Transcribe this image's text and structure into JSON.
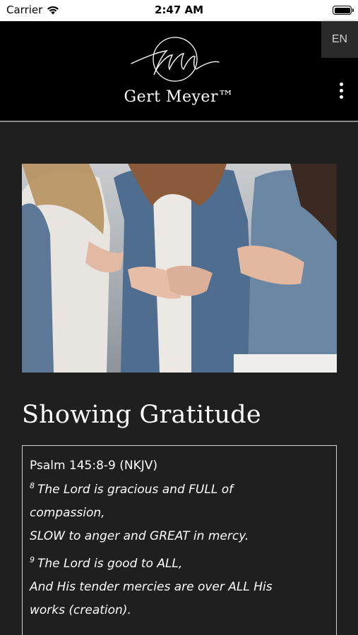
{
  "status_bar": {
    "carrier": "Carrier",
    "time": "2:47 AM",
    "wifi_icon": "wifi-icon",
    "battery_icon": "battery-icon"
  },
  "header": {
    "logo_monogram": "gm",
    "brand_name": "Gert Meyer™",
    "language_label": "EN",
    "menu_icon": "vertical-dots-icon",
    "background_color": "#000000"
  },
  "main": {
    "hero_image_alt": "Women in denim jackets holding hands",
    "title": "Showing Gratitude",
    "scripture": {
      "reference": "Psalm 145:8-9 (NKJV)",
      "lines": [
        {
          "sup": "8",
          "text": "The Lord is gracious and FULL of"
        },
        {
          "sup": "",
          "text": "compassion,"
        },
        {
          "sup": "",
          "text": "SLOW to anger and GREAT in mercy."
        },
        {
          "sup": "9",
          "text": "The Lord is good to ALL,"
        },
        {
          "sup": "",
          "text": "And His tender mercies are over ALL His"
        },
        {
          "sup": "",
          "text": "works (creation)."
        }
      ]
    },
    "background_color": "#1f1f1f"
  }
}
